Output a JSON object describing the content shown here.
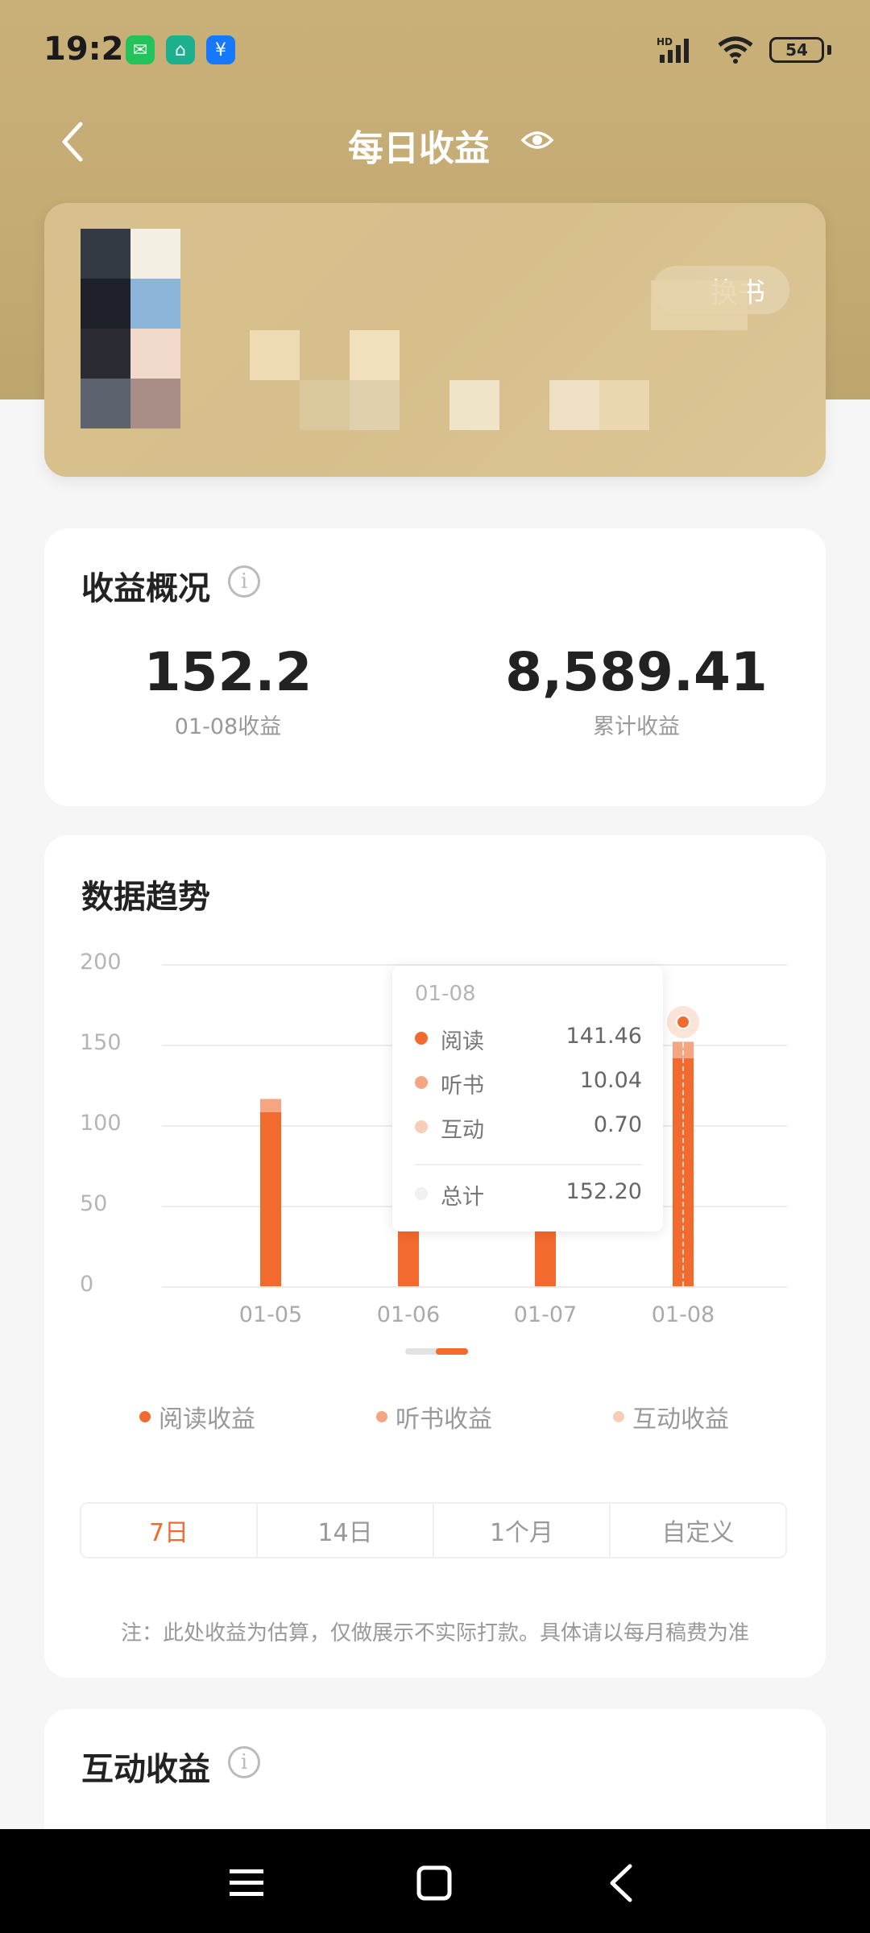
{
  "status_bar": {
    "time": "19:26",
    "notifications": [
      "wechat-icon",
      "mi-home-icon",
      "alipay-icon"
    ],
    "battery": "54",
    "signal_label": "HD"
  },
  "header": {
    "title": "每日收益"
  },
  "book_card": {
    "switch_label": "换书"
  },
  "overview": {
    "title": "收益概况",
    "today_value": "152.2",
    "today_label": "01-08收益",
    "total_value": "8,589.41",
    "total_label": "累计收益"
  },
  "trend": {
    "title": "数据趋势",
    "legend": [
      {
        "label": "阅读收益",
        "color": "#f26a2e"
      },
      {
        "label": "听书收益",
        "color": "#f5a582"
      },
      {
        "label": "互动收益",
        "color": "#f8cdb8"
      }
    ],
    "tooltip": {
      "date": "01-08",
      "rows": [
        {
          "label": "阅读",
          "value": "141.46",
          "color": "#f26a2e"
        },
        {
          "label": "听书",
          "value": "10.04",
          "color": "#f5a582"
        },
        {
          "label": "互动",
          "value": "0.70",
          "color": "#f8cdb8"
        }
      ],
      "total_label": "总计",
      "total_value": "152.20"
    },
    "range_tabs": [
      {
        "label": "7日",
        "active": true
      },
      {
        "label": "14日",
        "active": false
      },
      {
        "label": "1个月",
        "active": false
      },
      {
        "label": "自定义",
        "active": false
      }
    ],
    "note": "注：此处收益为估算，仅做展示不实际打款。具体请以每月稿费为准"
  },
  "chart_data": {
    "type": "bar",
    "stacked": true,
    "categories": [
      "01-05",
      "01-06",
      "01-07",
      "01-08"
    ],
    "series": [
      {
        "name": "阅读收益",
        "values": [
          108,
          95,
          100,
          141.46
        ]
      },
      {
        "name": "听书收益",
        "values": [
          8,
          8,
          8,
          10.04
        ]
      },
      {
        "name": "互动收益",
        "values": [
          0.5,
          0.5,
          0.5,
          0.7
        ]
      }
    ],
    "y_ticks": [
      "200",
      "150",
      "100",
      "50",
      "0"
    ],
    "ylim": [
      0,
      200
    ],
    "grid": true,
    "legend": "bottom"
  },
  "interact": {
    "title": "互动收益"
  }
}
